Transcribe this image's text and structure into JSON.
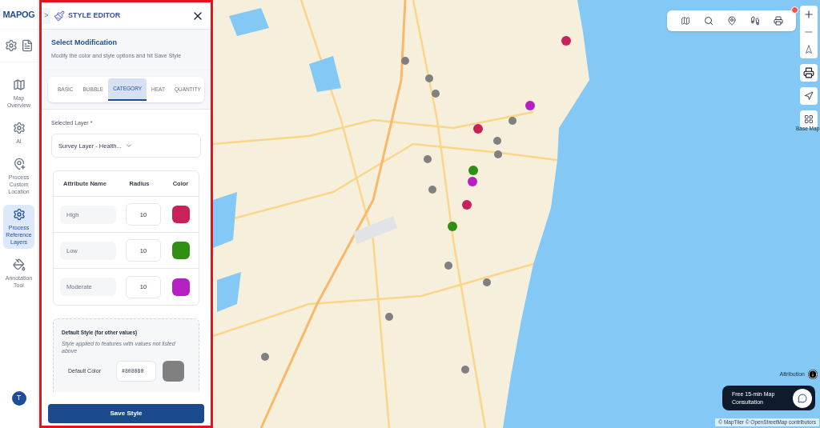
{
  "logo": {
    "text": "MAPOG"
  },
  "sidebar": {
    "items": [
      {
        "label": "Map Overview",
        "kind": "map",
        "selected": false
      },
      {
        "label": "AI",
        "kind": "ai",
        "selected": false
      },
      {
        "label": "Process Custom Location",
        "kind": "pin",
        "selected": false
      },
      {
        "label": "Process Reference Layers",
        "kind": "layers",
        "selected": true
      },
      {
        "label": "Annotation Tool",
        "kind": "annotate",
        "selected": false
      }
    ],
    "avatar": "T"
  },
  "panel": {
    "title": "STYLE EDITOR",
    "expand": ">",
    "section_title": "Select Modification",
    "section_subtitle": "Modify the color and style options and hit Save Style",
    "tabs": [
      {
        "label": "BASIC",
        "selected": false
      },
      {
        "label": "BUBBLE",
        "selected": false
      },
      {
        "label": "CATEGORY",
        "selected": true
      },
      {
        "label": "HEAT",
        "selected": false
      },
      {
        "label": "QUANTITY",
        "selected": false
      }
    ],
    "layer_label": "Selected Layer *",
    "layer_value": "Survey Layer - Health...",
    "table": {
      "columns": [
        "Attribute Name",
        "Radius",
        "Color"
      ],
      "rows": [
        {
          "name": "High",
          "radius": "10",
          "color": "#c9215a"
        },
        {
          "name": "Low",
          "radius": "10",
          "color": "#2f8f12"
        },
        {
          "name": "Moderate",
          "radius": "10",
          "color": "#b620c2"
        }
      ]
    },
    "default_style": {
      "title": "Default Style (for other values)",
      "subtitle": "Style applied to features with values not listed above",
      "color_label": "Default Color",
      "color_value": "#808080",
      "color": "#808080"
    },
    "save_button": "Save Style"
  },
  "map": {
    "base_map_label": "Base Map",
    "attribution": "Attribution",
    "consult": "Free 15-min Map Consultation",
    "copyright": "© MapTiler © OpenStreetMap contributors"
  }
}
